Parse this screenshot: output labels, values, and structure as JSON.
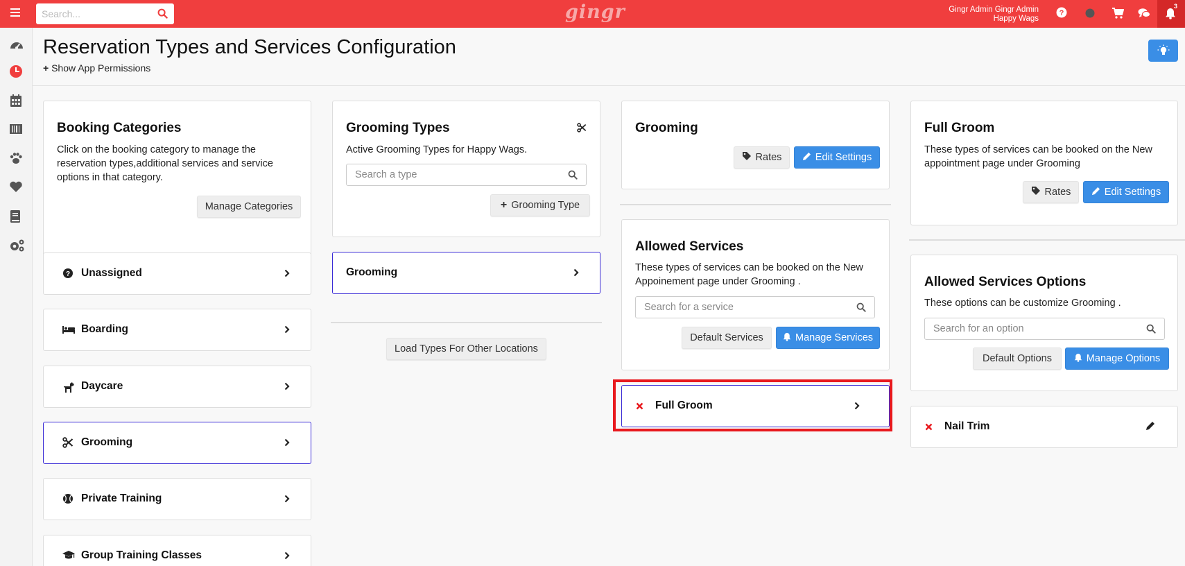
{
  "topbar": {
    "search_placeholder": "Search...",
    "logo": "gingr",
    "user_name": "Gingr Admin Gingr Admin",
    "location": "Happy Wags",
    "notification_count": "3"
  },
  "page": {
    "title": "Reservation Types and Services Configuration",
    "permissions_link": "Show App Permissions"
  },
  "booking_categories": {
    "title": "Booking Categories",
    "description": "Click on the booking category to manage the reservation types,additional services and service options in that category.",
    "manage_button": "Manage Categories",
    "items": [
      {
        "label": "Unassigned",
        "icon": "question-circle-icon"
      },
      {
        "label": "Boarding",
        "icon": "bed-icon"
      },
      {
        "label": "Daycare",
        "icon": "dog-icon"
      },
      {
        "label": "Grooming",
        "icon": "scissors-icon"
      },
      {
        "label": "Private Training",
        "icon": "ball-icon"
      },
      {
        "label": "Group Training Classes",
        "icon": "graduation-cap-icon"
      }
    ]
  },
  "grooming_types": {
    "title": "Grooming Types",
    "description": "Active Grooming Types for Happy Wags.",
    "search_placeholder": "Search a type",
    "add_button": "Grooming Type",
    "selected_type": "Grooming",
    "load_button": "Load Types For Other Locations"
  },
  "grooming_detail": {
    "title": "Grooming",
    "rates_button": "Rates",
    "edit_button": "Edit Settings"
  },
  "allowed_services": {
    "title": "Allowed Services",
    "description": "These types of services can be booked on the New Appoinement page under Grooming .",
    "search_placeholder": "Search for a service",
    "default_button": "Default Services",
    "manage_button": "Manage Services",
    "items": [
      {
        "label": "Full Groom"
      }
    ]
  },
  "full_groom": {
    "title": "Full Groom",
    "description": "These types of services can be booked on the New appointment page under Grooming",
    "rates_button": "Rates",
    "edit_button": "Edit Settings"
  },
  "allowed_options": {
    "title": "Allowed Services Options",
    "description": "These options can be customize Grooming .",
    "search_placeholder": "Search for an option",
    "default_button": "Default Options",
    "manage_button": "Manage Options",
    "items": [
      {
        "label": "Nail Trim"
      }
    ]
  },
  "colors": {
    "topbar": "#f03e3e",
    "primary": "#3a8ee6",
    "active_border": "#3a2bd6",
    "highlight": "#e8191e",
    "remove_x": "#e8191e"
  }
}
